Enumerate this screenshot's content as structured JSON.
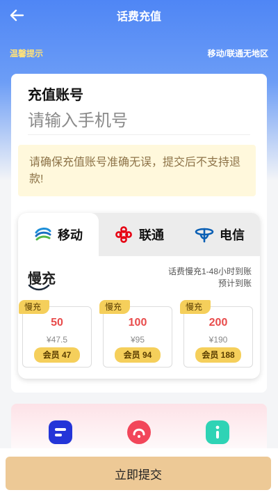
{
  "header": {
    "title": "话费充值"
  },
  "notice": {
    "tip_link": "温馨提示",
    "region": "移动/联通无地区"
  },
  "account": {
    "label": "充值账号",
    "placeholder": "请输入手机号",
    "warning": "请确保充值账号准确无误，提交后不支持退款!"
  },
  "operators": {
    "tabs": [
      {
        "label": "移动",
        "icon": "china-mobile-icon"
      },
      {
        "label": "联通",
        "icon": "china-unicom-icon"
      },
      {
        "label": "电信",
        "icon": "china-telecom-icon"
      }
    ],
    "active_tab": "移动"
  },
  "speed": {
    "title": "慢充",
    "desc_line1": "话费慢充1-48小时到账",
    "desc_line2": "预计到账"
  },
  "packages": [
    {
      "tag": "慢充",
      "amount": "50",
      "price": "¥47.5",
      "member": "会员 47"
    },
    {
      "tag": "慢充",
      "amount": "100",
      "price": "¥95",
      "member": "会员 94"
    },
    {
      "tag": "慢充",
      "amount": "200",
      "price": "¥190",
      "member": "会员 188"
    }
  ],
  "bottom_icons": [
    "menu-app-icon",
    "headset-support-icon",
    "info-icon"
  ],
  "colors": {
    "brand_blue": "#4f86f5",
    "accent_gold": "#f5cf5b",
    "price_red": "#e84b4b",
    "submit_bg": "#edc996"
  },
  "footer": {
    "submit_label": "立即提交"
  }
}
